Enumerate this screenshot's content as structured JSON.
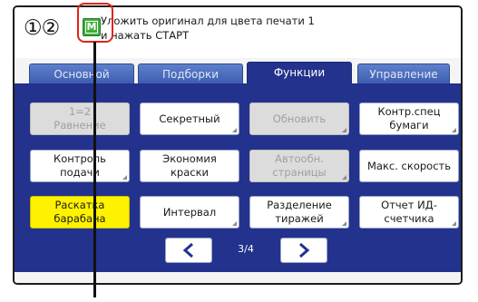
{
  "status": {
    "circled_numbers": "①②",
    "icon_letter": "M",
    "message_line1": "Уложить оригинал для цвета печати 1",
    "message_line2": "и нажать СТАРТ"
  },
  "tabs": [
    {
      "label": "Основной",
      "active": false
    },
    {
      "label": "Подборки",
      "active": false
    },
    {
      "label": "Функции",
      "active": true
    },
    {
      "label": "Управление",
      "active": false
    }
  ],
  "buttons": [
    {
      "label": "1=2\nРавнение",
      "state": "disabled"
    },
    {
      "label": "Секретный",
      "state": "normal"
    },
    {
      "label": "Обновить",
      "state": "disabled"
    },
    {
      "label": "Контр.спец\nбумаги",
      "state": "normal"
    },
    {
      "label": "Контроль\nподачи",
      "state": "normal"
    },
    {
      "label": "Экономия\nкраски",
      "state": "normal"
    },
    {
      "label": "Автообн.\nстраницы",
      "state": "disabled"
    },
    {
      "label": "Макс. скорость",
      "state": "normal"
    },
    {
      "label": "Раскатка\nбарабана",
      "state": "selected"
    },
    {
      "label": "Интервал",
      "state": "normal"
    },
    {
      "label": "Разделение\nтиражей",
      "state": "normal"
    },
    {
      "label": "Отчет ИД-\nсчетчика",
      "state": "normal"
    }
  ],
  "pager": {
    "indicator": "3/4",
    "prev_icon": "chevron-left-icon",
    "next_icon": "chevron-right-icon"
  },
  "colors": {
    "panel": "#23328c",
    "tab": "#4a6bbf",
    "selected": "#fff200",
    "callout": "#e2231a",
    "icon_green": "#3fae3a",
    "chevron": "#23328c"
  }
}
